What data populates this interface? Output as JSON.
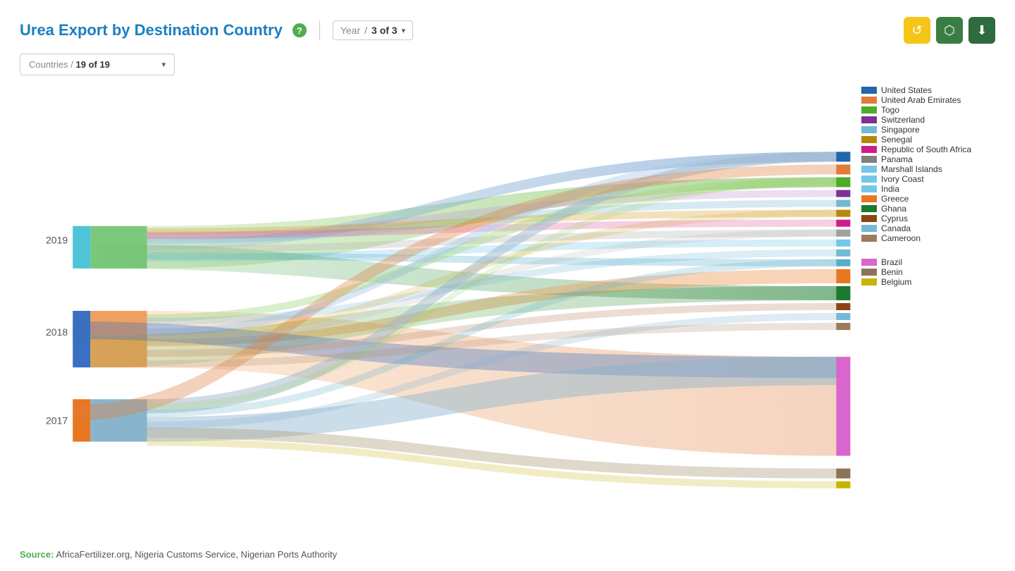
{
  "header": {
    "title": "Urea Export by Destination Country",
    "help_label": "?",
    "year_label": "Year",
    "year_value": "3 of 3"
  },
  "filter": {
    "label": "Countries",
    "value": "19 of 19"
  },
  "toolbar": {
    "refresh_icon": "↺",
    "camera_icon": "📷",
    "download_icon": "⬇"
  },
  "legend": [
    {
      "label": "United States",
      "color": "#2166ac"
    },
    {
      "label": "United Arab Emirates",
      "color": "#e07b39"
    },
    {
      "label": "Togo",
      "color": "#4dac26"
    },
    {
      "label": "Switzerland",
      "color": "#7b3294"
    },
    {
      "label": "Singapore",
      "color": "#74b9d4"
    },
    {
      "label": "Senegal",
      "color": "#b8860b"
    },
    {
      "label": "Republic of South Africa",
      "color": "#d01c8b"
    },
    {
      "label": "Panama",
      "color": "#808080"
    },
    {
      "label": "Marshall Islands",
      "color": "#74c7e8"
    },
    {
      "label": "Ivory Coast",
      "color": "#74c7e8"
    },
    {
      "label": "India",
      "color": "#74c7e8"
    },
    {
      "label": "Greece",
      "color": "#e87722"
    },
    {
      "label": "Ghana",
      "color": "#1a7a2e"
    },
    {
      "label": "Cyprus",
      "color": "#8B4513"
    },
    {
      "label": "Canada",
      "color": "#74b9d4"
    },
    {
      "label": "Cameroon",
      "color": "#9c7c5b"
    },
    {
      "label": "Brazil",
      "color": "#d966cc"
    },
    {
      "label": "Benin",
      "color": "#8B7355"
    },
    {
      "label": "Belgium",
      "color": "#c8b400"
    }
  ],
  "years": [
    "2019",
    "2018",
    "2017"
  ],
  "source_label": "Source:",
  "source_text": " AfricaFertilizer.org, Nigeria Customs Service, Nigerian Ports Authority"
}
